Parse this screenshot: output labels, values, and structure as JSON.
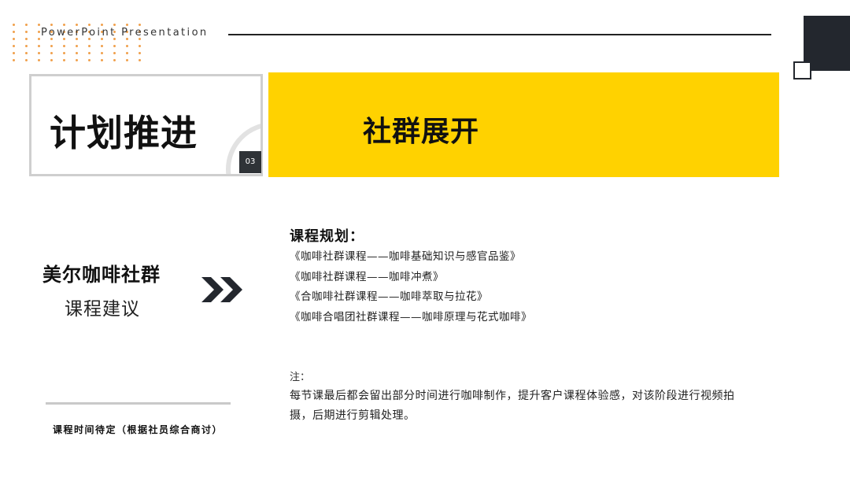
{
  "header": {
    "label": "PowerPoint Presentation"
  },
  "title_box": {
    "title": "计划推进",
    "page_number": "03"
  },
  "banner": {
    "title": "社群展开"
  },
  "left_panel": {
    "title": "美尔咖啡社群",
    "subtitle": "课程建议",
    "footnote": "课程时间待定（根据社员综合商讨）"
  },
  "plan": {
    "heading": "课程规划：",
    "items": [
      "《咖啡社群课程——咖啡基础知识与感官品鉴》",
      "《咖啡社群课程——咖啡冲煮》",
      "《合咖啡社群课程——咖啡萃取与拉花》",
      "《咖啡合唱团社群课程——咖啡原理与花式咖啡》"
    ]
  },
  "note": {
    "label": "注：",
    "body": "每节课最后都会留出部分时间进行咖啡制作，提升客户课程体验感，对该阶段进行视频拍摄，后期进行剪辑处理。"
  },
  "colors": {
    "accent_yellow": "#ffd200",
    "dark": "#23272e",
    "dot_orange": "#f0a04b",
    "border_gray": "#cfcfcf"
  },
  "icons": {
    "chevrons": "double-chevron-right-icon"
  }
}
